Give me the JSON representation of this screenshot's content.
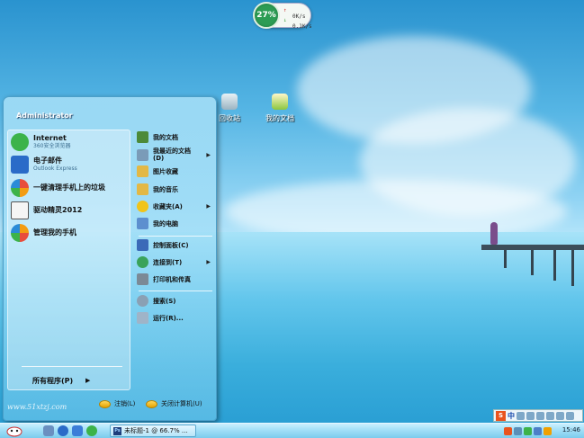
{
  "network_widget": {
    "percent": "27%",
    "up_speed": "0K/s",
    "down_speed": "0.1K/s",
    "up_arrow": "↑",
    "down_arrow": "↓"
  },
  "desktop_icons": [
    {
      "label": "回收站",
      "icon": "recycle-bin-icon"
    },
    {
      "label": "我的文档",
      "icon": "my-documents-icon"
    }
  ],
  "start_menu": {
    "user": "Administrator",
    "pinned": [
      {
        "title": "Internet",
        "subtitle": "360安全浏览器",
        "icon": "browser-icon",
        "color": "#3cb34a"
      },
      {
        "title": "电子邮件",
        "subtitle": "Outlook Express",
        "icon": "email-icon",
        "color": "#2a6bc8"
      },
      {
        "title": "一键清理手机上的垃圾",
        "subtitle": "",
        "icon": "phone-clean-icon",
        "color": "#e84d3d"
      },
      {
        "title": "驱动精灵2012",
        "subtitle": "",
        "icon": "driver-genius-icon",
        "color": "#f5f5f5"
      },
      {
        "title": "管理我的手机",
        "subtitle": "",
        "icon": "phone-manager-icon",
        "color": "#f39c12"
      }
    ],
    "all_programs": "所有程序(P)",
    "all_programs_arrow": "▶",
    "right": [
      {
        "label": "我的文档",
        "icon": "my-docs-icon",
        "color": "#4c8a3a",
        "arrow": ""
      },
      {
        "label": "我最近的文档(D)",
        "icon": "recent-docs-icon",
        "color": "#7a9bb8",
        "arrow": "▶"
      },
      {
        "label": "图片收藏",
        "icon": "pictures-icon",
        "color": "#e2b846",
        "arrow": ""
      },
      {
        "label": "我的音乐",
        "icon": "music-icon",
        "color": "#e2b846",
        "arrow": ""
      },
      {
        "label": "收藏夹(A)",
        "icon": "favorites-icon",
        "color": "#f0c419",
        "arrow": "▶"
      },
      {
        "label": "我的电脑",
        "icon": "my-computer-icon",
        "color": "#5c8fcf",
        "arrow": ""
      },
      {
        "label": "控制面板(C)",
        "icon": "control-panel-icon",
        "color": "#3b6ab8",
        "arrow": ""
      },
      {
        "label": "连接到(T)",
        "icon": "connect-icon",
        "color": "#3aa35b",
        "arrow": "▶"
      },
      {
        "label": "打印机和传真",
        "icon": "printer-icon",
        "color": "#7b8a96",
        "arrow": ""
      },
      {
        "label": "搜索(S)",
        "icon": "search-icon",
        "color": "#8aa0b4",
        "arrow": ""
      },
      {
        "label": "运行(R)...",
        "icon": "run-icon",
        "color": "#9fb4c8",
        "arrow": ""
      }
    ],
    "logoff": "注销(L)",
    "shutdown": "关闭计算机(U)"
  },
  "watermark": "www.51xtzj.com",
  "taskbar": {
    "task_label": "未标题-1 @ 66.7% ...",
    "task_icon_text": "Ps",
    "clock": "15:46"
  },
  "ime": {
    "logo": "S",
    "lang": "中"
  }
}
